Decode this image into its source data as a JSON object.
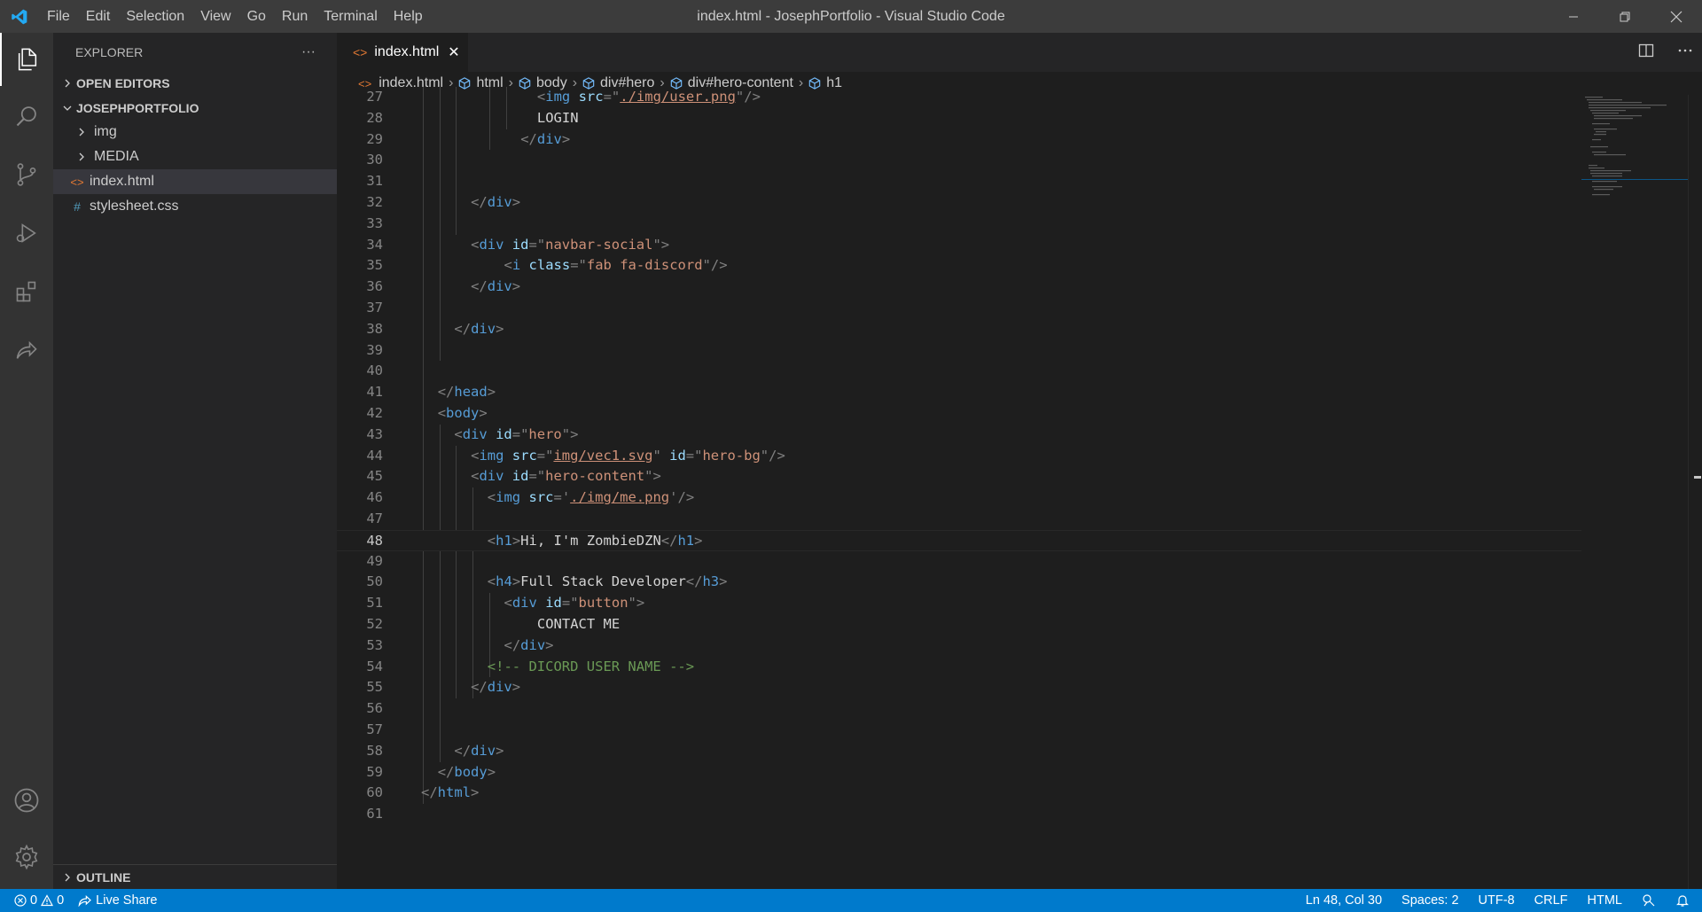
{
  "titlebar": {
    "menu": [
      "File",
      "Edit",
      "Selection",
      "View",
      "Go",
      "Run",
      "Terminal",
      "Help"
    ],
    "title": "index.html - JosephPortfolio - Visual Studio Code"
  },
  "sidebar": {
    "header": "EXPLORER",
    "more": "···",
    "open_editors": "OPEN EDITORS",
    "project": "JOSEPHPORTFOLIO",
    "items": [
      {
        "label": "img",
        "type": "folder"
      },
      {
        "label": "MEDIA",
        "type": "folder"
      },
      {
        "label": "index.html",
        "type": "html",
        "selected": true
      },
      {
        "label": "stylesheet.css",
        "type": "css"
      }
    ],
    "outline": "OUTLINE"
  },
  "tab": {
    "label": "index.html",
    "close": "✕"
  },
  "breadcrumb": [
    "index.html",
    "html",
    "body",
    "div#hero",
    "div#hero-content",
    "h1"
  ],
  "editor": {
    "current_line": 48,
    "lines": [
      {
        "n": "27",
        "indent": 7,
        "tokens": [
          [
            "tag-open",
            "<"
          ],
          [
            "tag",
            "img"
          ],
          [
            "sp",
            " "
          ],
          [
            "attr",
            "src"
          ],
          [
            "punc",
            "=\""
          ],
          [
            "link",
            "./img/user.png"
          ],
          [
            "punc",
            "\""
          ],
          [
            "tag-open",
            "/>"
          ]
        ]
      },
      {
        "n": "28",
        "indent": 7,
        "tokens": [
          [
            "txt",
            "LOGIN"
          ]
        ]
      },
      {
        "n": "29",
        "indent": 6,
        "tokens": [
          [
            "tag-open",
            "</"
          ],
          [
            "tag",
            "div"
          ],
          [
            "tag-open",
            ">"
          ]
        ]
      },
      {
        "n": "30",
        "indent": 0,
        "tokens": []
      },
      {
        "n": "31",
        "indent": 0,
        "tokens": []
      },
      {
        "n": "32",
        "indent": 3,
        "tokens": [
          [
            "tag-open",
            "</"
          ],
          [
            "tag",
            "div"
          ],
          [
            "tag-open",
            ">"
          ]
        ]
      },
      {
        "n": "33",
        "indent": 0,
        "tokens": []
      },
      {
        "n": "34",
        "indent": 3,
        "tokens": [
          [
            "tag-open",
            "<"
          ],
          [
            "tag",
            "div"
          ],
          [
            "sp",
            " "
          ],
          [
            "attr",
            "id"
          ],
          [
            "punc",
            "=\""
          ],
          [
            "str",
            "navbar-social"
          ],
          [
            "punc",
            "\""
          ],
          [
            "tag-open",
            ">"
          ]
        ]
      },
      {
        "n": "35",
        "indent": 5,
        "tokens": [
          [
            "tag-open",
            "<"
          ],
          [
            "tag",
            "i"
          ],
          [
            "sp",
            " "
          ],
          [
            "attr",
            "class"
          ],
          [
            "punc",
            "=\""
          ],
          [
            "str",
            "fab fa-discord"
          ],
          [
            "punc",
            "\""
          ],
          [
            "tag-open",
            "/>"
          ]
        ]
      },
      {
        "n": "36",
        "indent": 3,
        "tokens": [
          [
            "tag-open",
            "</"
          ],
          [
            "tag",
            "div"
          ],
          [
            "tag-open",
            ">"
          ]
        ]
      },
      {
        "n": "37",
        "indent": 0,
        "tokens": []
      },
      {
        "n": "38",
        "indent": 2,
        "tokens": [
          [
            "tag-open",
            "</"
          ],
          [
            "tag",
            "div"
          ],
          [
            "tag-open",
            ">"
          ]
        ]
      },
      {
        "n": "39",
        "indent": 0,
        "tokens": []
      },
      {
        "n": "40",
        "indent": 0,
        "tokens": []
      },
      {
        "n": "41",
        "indent": 1,
        "tokens": [
          [
            "tag-open",
            "</"
          ],
          [
            "tag",
            "head"
          ],
          [
            "tag-open",
            ">"
          ]
        ]
      },
      {
        "n": "42",
        "indent": 1,
        "tokens": [
          [
            "tag-open",
            "<"
          ],
          [
            "tag",
            "body"
          ],
          [
            "tag-open",
            ">"
          ]
        ]
      },
      {
        "n": "43",
        "indent": 2,
        "tokens": [
          [
            "tag-open",
            "<"
          ],
          [
            "tag",
            "div"
          ],
          [
            "sp",
            " "
          ],
          [
            "attr",
            "id"
          ],
          [
            "punc",
            "=\""
          ],
          [
            "str",
            "hero"
          ],
          [
            "punc",
            "\""
          ],
          [
            "tag-open",
            ">"
          ]
        ]
      },
      {
        "n": "44",
        "indent": 3,
        "tokens": [
          [
            "tag-open",
            "<"
          ],
          [
            "tag",
            "img"
          ],
          [
            "sp",
            " "
          ],
          [
            "attr",
            "src"
          ],
          [
            "punc",
            "=\""
          ],
          [
            "link",
            "img/vec1.svg"
          ],
          [
            "punc",
            "\""
          ],
          [
            "sp",
            " "
          ],
          [
            "attr",
            "id"
          ],
          [
            "punc",
            "=\""
          ],
          [
            "str",
            "hero-bg"
          ],
          [
            "punc",
            "\""
          ],
          [
            "tag-open",
            "/>"
          ]
        ]
      },
      {
        "n": "45",
        "indent": 3,
        "tokens": [
          [
            "tag-open",
            "<"
          ],
          [
            "tag",
            "div"
          ],
          [
            "sp",
            " "
          ],
          [
            "attr",
            "id"
          ],
          [
            "punc",
            "=\""
          ],
          [
            "str",
            "hero-content"
          ],
          [
            "punc",
            "\""
          ],
          [
            "tag-open",
            ">"
          ]
        ]
      },
      {
        "n": "46",
        "indent": 4,
        "tokens": [
          [
            "tag-open",
            "<"
          ],
          [
            "tag",
            "img"
          ],
          [
            "sp",
            " "
          ],
          [
            "attr",
            "src"
          ],
          [
            "punc",
            "='"
          ],
          [
            "link",
            "./img/me.png"
          ],
          [
            "punc",
            "'"
          ],
          [
            "tag-open",
            "/>"
          ]
        ]
      },
      {
        "n": "47",
        "indent": 0,
        "tokens": []
      },
      {
        "n": "48",
        "indent": 4,
        "tokens": [
          [
            "tag-open",
            "<"
          ],
          [
            "tag",
            "h1"
          ],
          [
            "tag-open",
            ">"
          ],
          [
            "txt",
            "Hi, I'm ZombieDZN"
          ],
          [
            "tag-open",
            "</"
          ],
          [
            "tag",
            "h1"
          ],
          [
            "tag-open",
            ">"
          ]
        ]
      },
      {
        "n": "49",
        "indent": 0,
        "tokens": []
      },
      {
        "n": "50",
        "indent": 4,
        "tokens": [
          [
            "tag-open",
            "<"
          ],
          [
            "tag",
            "h4"
          ],
          [
            "tag-open",
            ">"
          ],
          [
            "txt",
            "Full Stack Developer"
          ],
          [
            "tag-open",
            "</"
          ],
          [
            "tag",
            "h3"
          ],
          [
            "tag-open",
            ">"
          ]
        ]
      },
      {
        "n": "51",
        "indent": 5,
        "tokens": [
          [
            "tag-open",
            "<"
          ],
          [
            "tag",
            "div"
          ],
          [
            "sp",
            " "
          ],
          [
            "attr",
            "id"
          ],
          [
            "punc",
            "=\""
          ],
          [
            "str",
            "button"
          ],
          [
            "punc",
            "\""
          ],
          [
            "tag-open",
            ">"
          ]
        ]
      },
      {
        "n": "52",
        "indent": 7,
        "tokens": [
          [
            "txt",
            "CONTACT ME"
          ]
        ]
      },
      {
        "n": "53",
        "indent": 5,
        "tokens": [
          [
            "tag-open",
            "</"
          ],
          [
            "tag",
            "div"
          ],
          [
            "tag-open",
            ">"
          ]
        ]
      },
      {
        "n": "54",
        "indent": 4,
        "tokens": [
          [
            "cmt",
            "<!-- DICORD USER NAME -->"
          ]
        ]
      },
      {
        "n": "55",
        "indent": 3,
        "tokens": [
          [
            "tag-open",
            "</"
          ],
          [
            "tag",
            "div"
          ],
          [
            "tag-open",
            ">"
          ]
        ]
      },
      {
        "n": "56",
        "indent": 0,
        "tokens": []
      },
      {
        "n": "57",
        "indent": 0,
        "tokens": []
      },
      {
        "n": "58",
        "indent": 2,
        "tokens": [
          [
            "tag-open",
            "</"
          ],
          [
            "tag",
            "div"
          ],
          [
            "tag-open",
            ">"
          ]
        ]
      },
      {
        "n": "59",
        "indent": 1,
        "tokens": [
          [
            "tag-open",
            "</"
          ],
          [
            "tag",
            "body"
          ],
          [
            "tag-open",
            ">"
          ]
        ]
      },
      {
        "n": "60",
        "indent": 0,
        "tokens": [
          [
            "tag-open",
            "</"
          ],
          [
            "tag",
            "html"
          ],
          [
            "tag-open",
            ">"
          ]
        ]
      },
      {
        "n": "61",
        "indent": 0,
        "tokens": []
      }
    ]
  },
  "statusbar": {
    "errors": "0",
    "warnings": "0",
    "live_share": "Live Share",
    "position": "Ln 48, Col 30",
    "spaces": "Spaces: 2",
    "encoding": "UTF-8",
    "eol": "CRLF",
    "language": "HTML"
  },
  "colors": {
    "accent": "#007acc",
    "tag": "#569cd6",
    "attribute": "#9cdcfe",
    "string": "#ce9178",
    "comment": "#6a9955",
    "html_icon": "#e37933",
    "css_icon": "#519aba"
  }
}
